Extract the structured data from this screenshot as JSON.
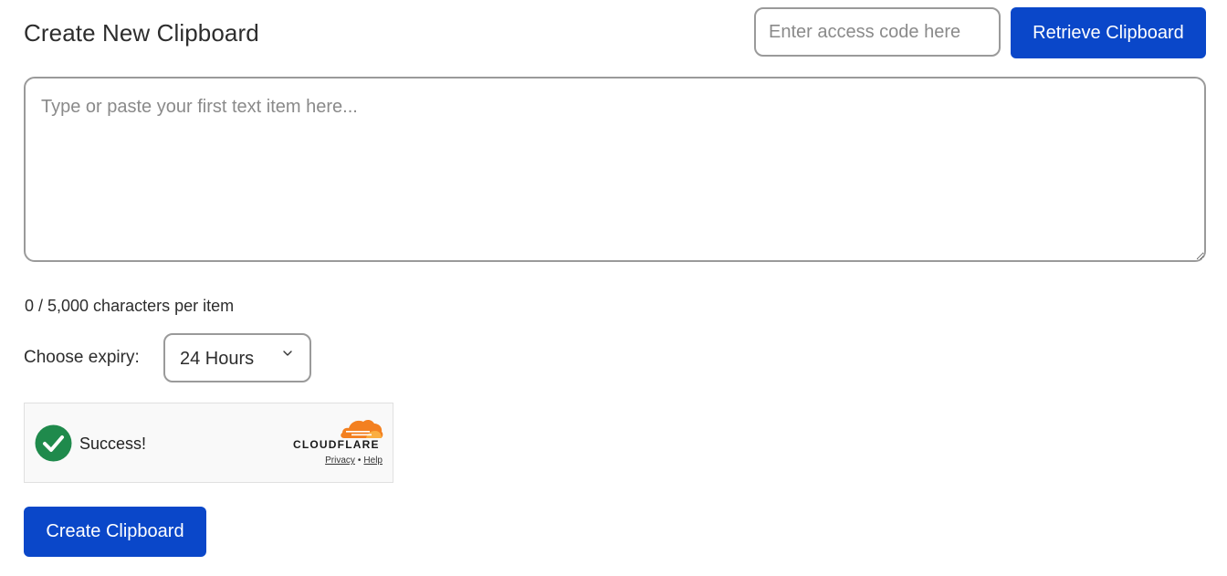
{
  "header": {
    "title": "Create New Clipboard",
    "access_code_placeholder": "Enter access code here",
    "retrieve_label": "Retrieve Clipboard"
  },
  "editor": {
    "placeholder": "Type or paste your first text item here..."
  },
  "counter": {
    "text": "0 / 5,000 characters per item"
  },
  "expiry": {
    "label": "Choose expiry:",
    "selected": "24 Hours"
  },
  "captcha": {
    "status": "Success!",
    "brand": "CLOUDFLARE",
    "privacy_label": "Privacy",
    "separator": "•",
    "help_label": "Help",
    "success_color": "#1f8a4c",
    "brand_color": "#f38020"
  },
  "actions": {
    "create_label": "Create Clipboard",
    "button_color": "#0a47c9"
  }
}
